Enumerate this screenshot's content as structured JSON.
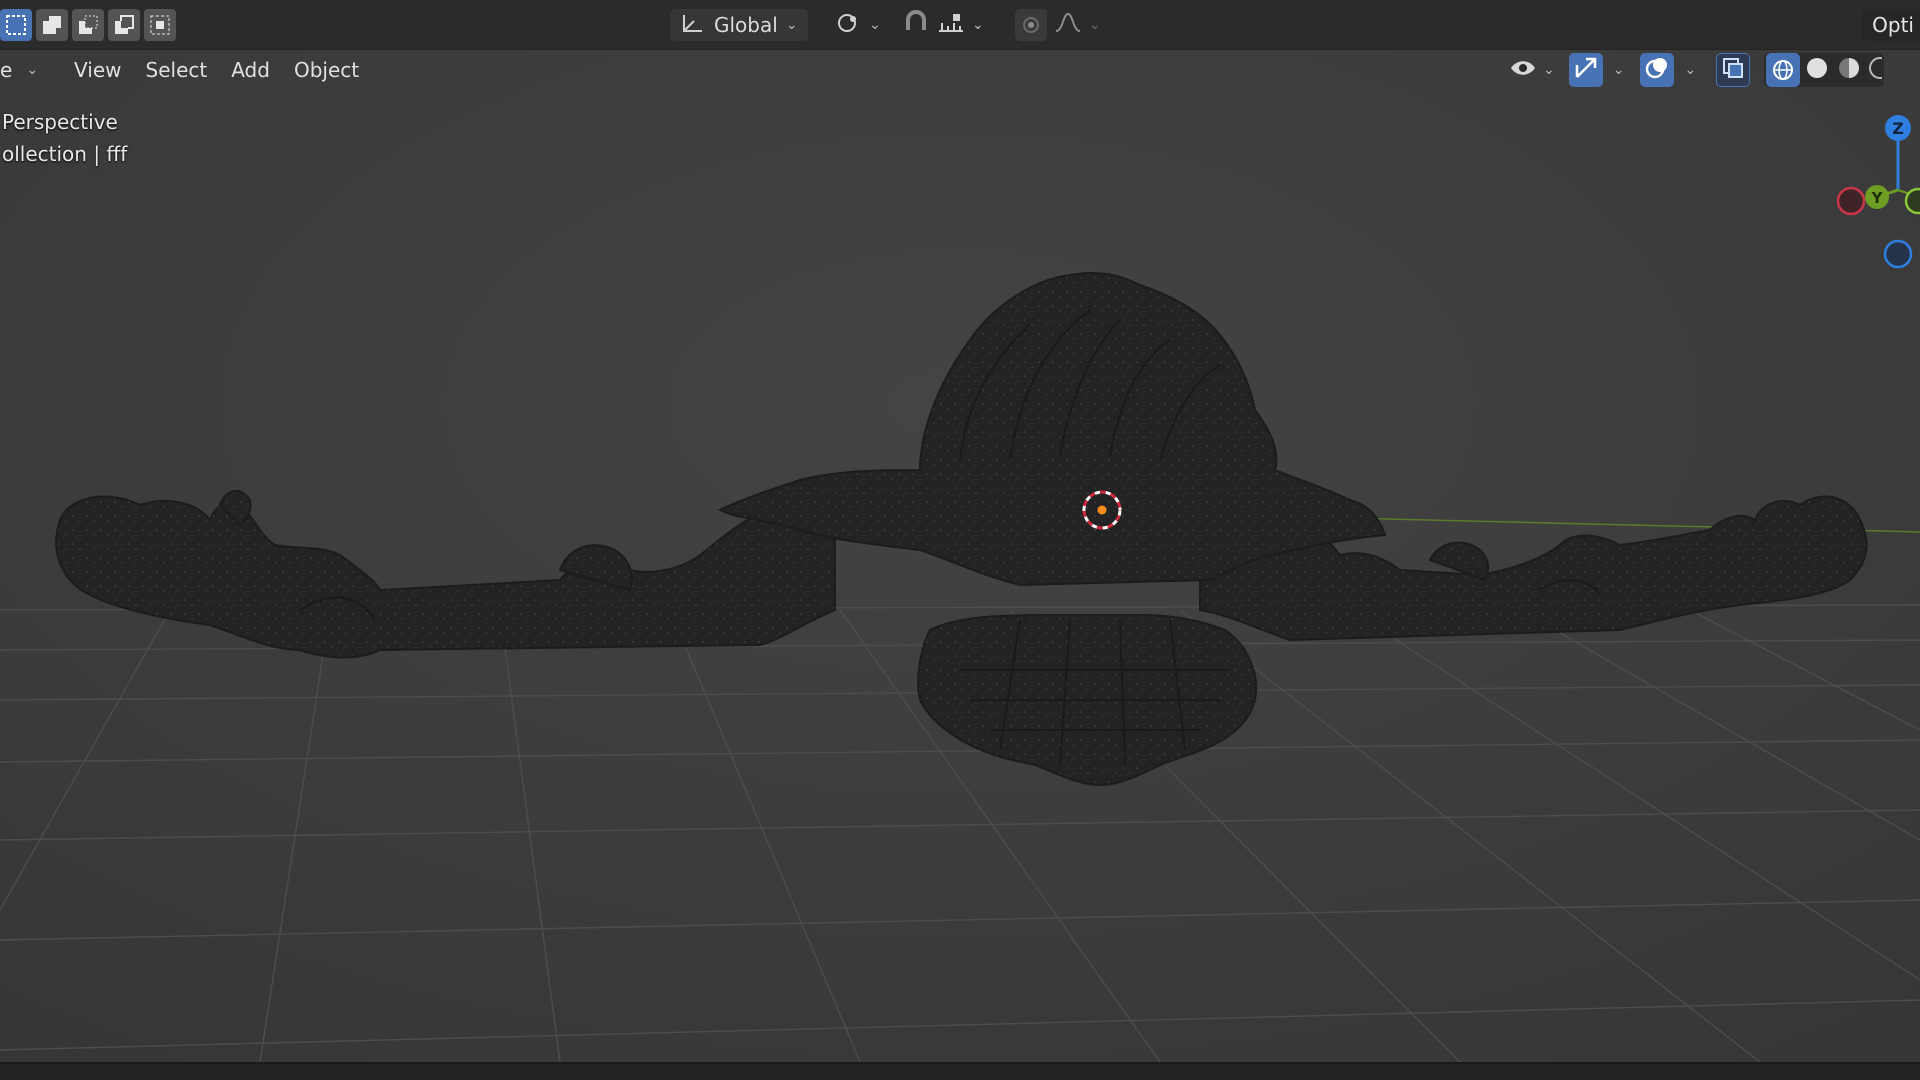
{
  "header": {
    "selection_modes": [
      {
        "name": "select-new-icon",
        "active": true
      },
      {
        "name": "select-extend-icon",
        "active": false
      },
      {
        "name": "select-subtract-icon",
        "active": false
      },
      {
        "name": "select-difference-icon",
        "active": false
      },
      {
        "name": "select-intersect-icon",
        "active": false
      }
    ],
    "orientation_label": "Global",
    "options_label": "Opti"
  },
  "viewport_menu": {
    "mode_label": "e",
    "items": [
      "View",
      "Select",
      "Add",
      "Object"
    ]
  },
  "viewport_info": {
    "view_name": "Perspective",
    "collection_text": "ollection | fff"
  },
  "gizmo": {
    "z_label": "Z",
    "y_label": "Y"
  },
  "colors": {
    "accent": "#4772b3",
    "axis_x": "#c9364a",
    "axis_y": "#6e9e23",
    "axis_z": "#2f7fe0",
    "cursor_orange": "#ff8c1a"
  }
}
